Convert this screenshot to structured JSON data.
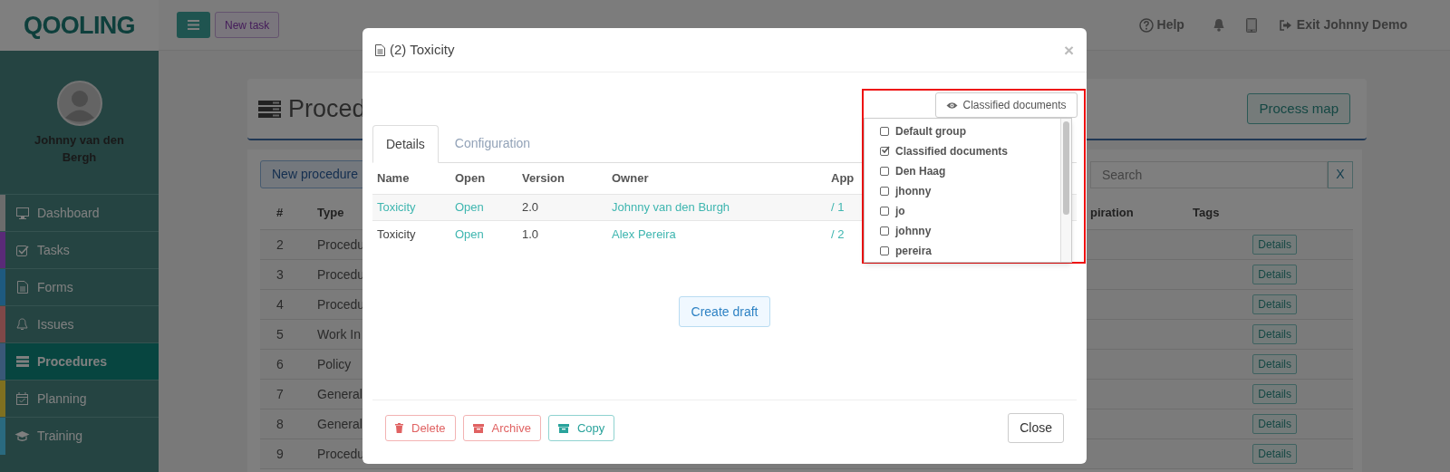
{
  "topbar": {
    "logo": "QOOLING",
    "new_task": "New task",
    "help": "Help",
    "exit": "Exit Johnny Demo"
  },
  "sidebar": {
    "user": "Johnny van den Bergh",
    "items": [
      {
        "label": "Dashboard",
        "color": "#6c6c6c",
        "selected": false
      },
      {
        "label": "Tasks",
        "color": "#5a2a78",
        "selected": false
      },
      {
        "label": "Forms",
        "color": "#1e5a82",
        "selected": false
      },
      {
        "label": "Issues",
        "color": "#8a4848",
        "selected": false
      },
      {
        "label": "Procedures",
        "color": "#3a5878",
        "selected": true
      },
      {
        "label": "Planning",
        "color": "#807020",
        "selected": false
      },
      {
        "label": "Training",
        "color": "#2a6a8a",
        "selected": false
      }
    ]
  },
  "page": {
    "title": "Proced",
    "process_map": "Process map",
    "new_procedure": "New procedure",
    "search": {
      "placeholder": "Search"
    },
    "clear": "X",
    "columns": [
      "#",
      "Type"
    ],
    "right_columns": [
      "piration",
      "Tags"
    ],
    "rows": [
      {
        "number": "2",
        "type": "Procedu",
        "action": "Details"
      },
      {
        "number": "3",
        "type": "Procedu",
        "action": "Details"
      },
      {
        "number": "4",
        "type": "Procedu",
        "action": "Details"
      },
      {
        "number": "5",
        "type": "Work In",
        "action": "Details"
      },
      {
        "number": "6",
        "type": "Policy",
        "action": "Details"
      },
      {
        "number": "7",
        "type": "General",
        "action": "Details"
      },
      {
        "number": "8",
        "type": "General",
        "action": "Details"
      },
      {
        "number": "9",
        "type": "Procedu",
        "action": "Details"
      }
    ]
  },
  "modal": {
    "title": "(2) Toxicity",
    "close": "×",
    "tabs": [
      {
        "label": "Details",
        "selected": true
      },
      {
        "label": "Configuration",
        "selected": false
      }
    ],
    "columns": [
      "Name",
      "Open",
      "Version",
      "Owner",
      "App"
    ],
    "rows": [
      {
        "selected": true,
        "cells": [
          {
            "text": "Toxicity",
            "link": true
          },
          {
            "text": "Open",
            "link": true
          },
          {
            "text": "2.0",
            "link": false
          },
          {
            "text": "Johnny van den Burgh",
            "link": true
          },
          {
            "text": "/ 1",
            "link": true
          }
        ]
      },
      {
        "selected": false,
        "cells": [
          {
            "text": "Toxicity",
            "link": false
          },
          {
            "text": "Open",
            "link": true
          },
          {
            "text": "1.0",
            "link": false
          },
          {
            "text": "Alex Pereira",
            "link": true
          },
          {
            "text": "/ 2",
            "link": true
          }
        ]
      }
    ],
    "create_draft": "Create draft",
    "groups": {
      "button": "Classified documents",
      "options": [
        {
          "label": "Default group",
          "checked": false
        },
        {
          "label": "Classified documents",
          "checked": true
        },
        {
          "label": "Den Haag",
          "checked": false
        },
        {
          "label": "jhonny",
          "checked": false
        },
        {
          "label": "jo",
          "checked": false
        },
        {
          "label": "johnny",
          "checked": false
        },
        {
          "label": "pereira",
          "checked": false
        }
      ]
    },
    "actions": [
      {
        "label": "Delete",
        "kind": "delete"
      },
      {
        "label": "Archive",
        "kind": "archive"
      },
      {
        "label": "Copy",
        "kind": "copy"
      }
    ],
    "close_button": "Close"
  }
}
